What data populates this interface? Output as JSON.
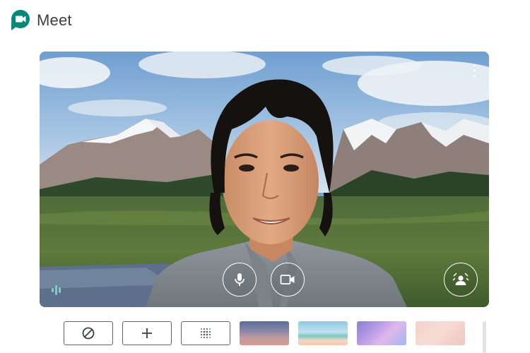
{
  "app": {
    "name": "Meet",
    "brand_colors": {
      "green": "#00ac47",
      "blue": "#4285f4",
      "yellow": "#ffba00",
      "red": "#ea4335"
    }
  },
  "preview": {
    "controls": {
      "more": {
        "icon": "more-vert-icon"
      },
      "microphone": {
        "icon": "microphone-icon",
        "state": "on"
      },
      "camera": {
        "icon": "video-camera-icon",
        "state": "on"
      },
      "effects": {
        "icon": "background-effects-icon"
      },
      "audio_indicator": {
        "icon": "audio-level-icon",
        "color": "#80cbc4"
      }
    }
  },
  "background_tray": {
    "options": [
      {
        "id": "none",
        "icon": "no-effect-icon"
      },
      {
        "id": "add",
        "icon": "plus-icon"
      },
      {
        "id": "blur",
        "icon": "blur-icon"
      },
      {
        "id": "sunset-gradient",
        "icon": "background-thumbnail"
      },
      {
        "id": "beach",
        "icon": "background-thumbnail"
      },
      {
        "id": "purple-clouds",
        "icon": "background-thumbnail"
      },
      {
        "id": "pink-sparkles",
        "icon": "background-thumbnail"
      }
    ]
  }
}
